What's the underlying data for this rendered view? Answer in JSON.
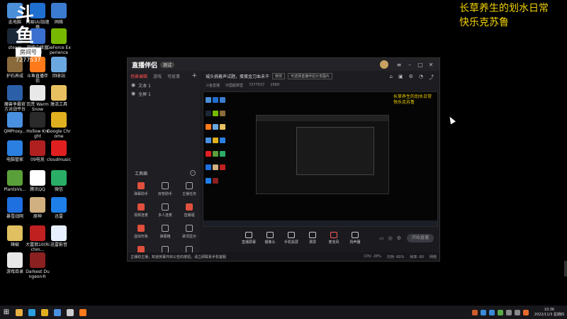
{
  "overlay": {
    "line1": "长草养生的划水日常",
    "line2": "快乐克苏鲁"
  },
  "watermark": {
    "brand": "斗鱼",
    "tag": "房间号",
    "room_number": "7277537"
  },
  "desktop_icons": [
    {
      "label": "此电脑",
      "icon": "computer-icon",
      "color": "#4a8fd8"
    },
    {
      "label": "网易UU加速器",
      "icon": "uu-accelerator-icon",
      "color": "#1f6fd0"
    },
    {
      "label": "网络",
      "icon": "network-icon",
      "color": "#3c7cd0"
    },
    {
      "label": "steam",
      "icon": "steam-icon",
      "color": "#1b2838"
    },
    {
      "label": "网络中级直播间",
      "icon": "live-room-icon",
      "color": "#3a6fd0"
    },
    {
      "label": "GeForce Experience",
      "icon": "geforce-icon",
      "color": "#76b900"
    },
    {
      "label": "护石养成",
      "icon": "game-icon",
      "color": "#8a6a3a"
    },
    {
      "label": "斗鱼直播伴侣",
      "icon": "douyu-companion-icon",
      "color": "#ff7a1a"
    },
    {
      "label": "回收站",
      "icon": "recycle-bin-icon",
      "color": "#6ca8e0"
    },
    {
      "label": "魔兽争霸官方对战平台",
      "icon": "warcraft-icon",
      "color": "#2b5fa8"
    },
    {
      "label": "饥荒 Warm Snow",
      "icon": "document-icon",
      "color": "#e8e8e8"
    },
    {
      "label": "激活工具",
      "icon": "folder-icon",
      "color": "#e8c060"
    },
    {
      "label": "QMProxy...",
      "icon": "qmproxy-icon",
      "color": "#4a90e0"
    },
    {
      "label": "Hollow Knight",
      "icon": "hollow-knight-icon",
      "color": "#2a2a2a"
    },
    {
      "label": "Google Chrome",
      "icon": "chrome-icon",
      "color": "#e0b020"
    },
    {
      "label": "电脑管家",
      "icon": "pc-manager-icon",
      "color": "#2a7fe0"
    },
    {
      "label": "09电竞",
      "icon": "esports-icon",
      "color": "#b02020"
    },
    {
      "label": "cloudmusic",
      "icon": "cloudmusic-icon",
      "color": "#e02020"
    },
    {
      "label": "PlantsVs...",
      "icon": "plants-icon",
      "color": "#5aa03a"
    },
    {
      "label": "腾讯QQ",
      "icon": "qq-icon",
      "color": "#ffffff"
    },
    {
      "label": "微信",
      "icon": "wechat-icon",
      "color": "#2aae67"
    },
    {
      "label": "暴雪战网",
      "icon": "battlenet-icon",
      "color": "#1e6fe0"
    },
    {
      "label": "原神",
      "icon": "genshin-icon",
      "color": "#d0b080"
    },
    {
      "label": "迅雷",
      "icon": "xunlei-icon",
      "color": "#1e7fe8"
    },
    {
      "label": "辣椒",
      "icon": "pepper-icon",
      "color": "#e0c060"
    },
    {
      "label": "大富翁10(Richm...",
      "icon": "richman-icon",
      "color": "#c02020"
    },
    {
      "label": "迅雷影音",
      "icon": "xunlei-player-icon",
      "color": "#e8f0ff"
    },
    {
      "label": "游戏目录",
      "icon": "game-dir-icon",
      "color": "#e8e8e8"
    },
    {
      "label": "Darkest Dungeon®",
      "icon": "darkest-dungeon-icon",
      "color": "#8a2020"
    }
  ],
  "app": {
    "logo": "直播伴侣",
    "version": "测试",
    "scene_tabs": [
      "场景编辑",
      "游戏",
      "可故事"
    ],
    "sources": [
      "文本 1",
      "全屏 1"
    ],
    "tools_title": "工具箱",
    "tools": [
      {
        "label": "弹幕助手",
        "highlight": true
      },
      {
        "label": "房管助手",
        "highlight": false
      },
      {
        "label": "主播任务",
        "highlight": false
      },
      {
        "label": "视频连麦",
        "highlight": true
      },
      {
        "label": "多人连麦",
        "highlight": false
      },
      {
        "label": "直播福",
        "highlight": true
      },
      {
        "label": "虚拟形象",
        "highlight": true
      },
      {
        "label": "弹幕箱",
        "highlight": false
      },
      {
        "label": "歌词显示",
        "highlight": false
      },
      {
        "label": "",
        "highlight": true
      },
      {
        "label": "",
        "highlight": false
      },
      {
        "label": "",
        "highlight": false
      }
    ],
    "header": {
      "title": "城头挑着声试题，蛋蛋金刀血未干",
      "chip1": "修改",
      "chip2": "可选择直播伴侣分享图片",
      "category": "斗鱼直播",
      "channel": "中国超频营",
      "room": "7277537",
      "viewers": "2589"
    },
    "preview_overlay": {
      "line1": "长草养生的划水日常",
      "line2": "快乐克苏鲁"
    },
    "controls": [
      {
        "label": "直播屏幕",
        "icon": "screen-icon"
      },
      {
        "label": "摄像头",
        "icon": "camera-icon"
      },
      {
        "label": "手机投屏",
        "icon": "phone-cast-icon"
      },
      {
        "label": "录屏",
        "icon": "record-icon"
      },
      {
        "label": "麦克风",
        "icon": "microphone-icon"
      },
      {
        "label": "扬声器",
        "icon": "speaker-icon"
      }
    ],
    "start_button": "开始直播",
    "status": {
      "announcement": "主播助主播，知道荧幕开启公告的按钮，请立即联系手机客服",
      "cpu": "CPU: 28%",
      "mem": "内存: 60%",
      "fps": "帧率: 60",
      "net": "网络"
    }
  },
  "clock": {
    "time": "10:36",
    "date": "2022/11/3 星期四"
  },
  "taskbar_items": [
    {
      "icon": "file-explorer-icon",
      "color": "#e8b040"
    },
    {
      "icon": "edge-icon",
      "color": "#2aa0e0"
    },
    {
      "icon": "chrome-icon",
      "color": "#e0b020"
    },
    {
      "icon": "qq-icon",
      "color": "#4a90e0"
    },
    {
      "icon": "obs-icon",
      "color": "#cccccc"
    },
    {
      "icon": "douyu-companion-icon",
      "color": "#ff7a1a"
    }
  ]
}
